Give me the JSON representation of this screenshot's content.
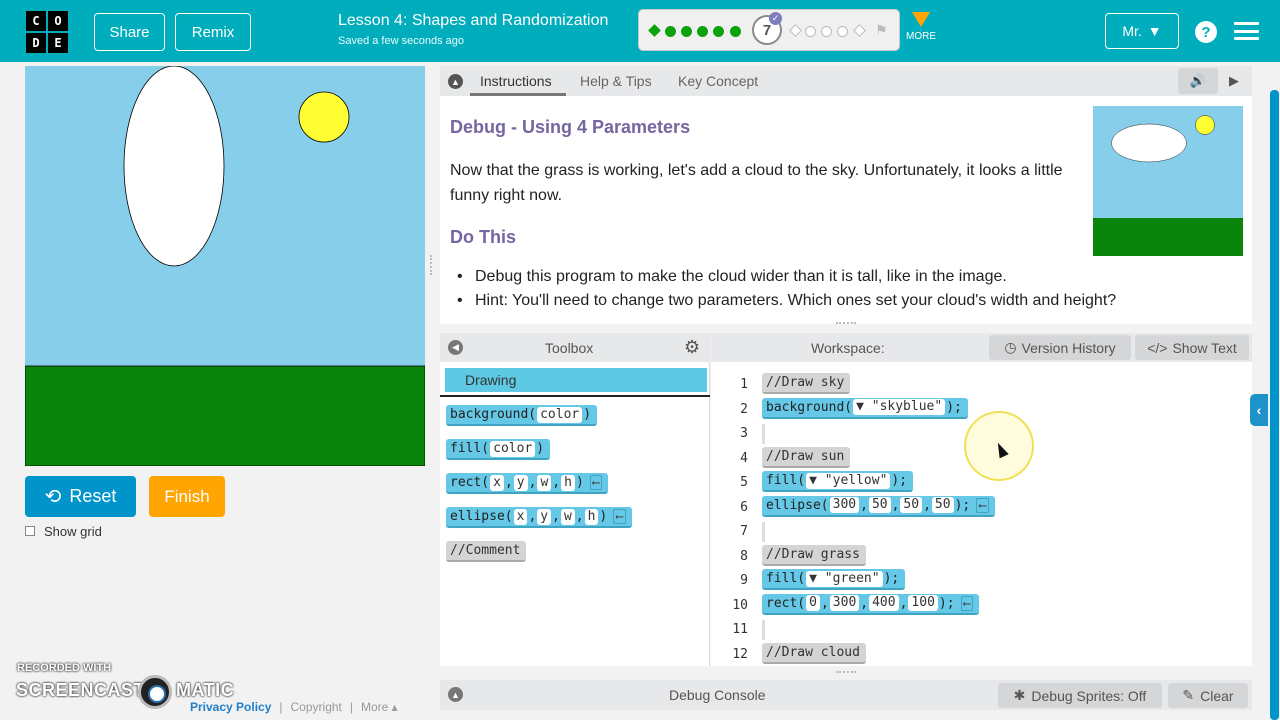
{
  "header": {
    "logo_letters": [
      "C",
      "O",
      "D",
      "E"
    ],
    "share_label": "Share",
    "remix_label": "Remix",
    "lesson_title": "Lesson 4: Shapes and Randomization",
    "saved_status": "Saved a few seconds ago",
    "progress": {
      "current_level": "7",
      "completed_levels": 6,
      "total_shown": 11
    },
    "more_label": "MORE",
    "user_label": "Mr.",
    "accent_color": "#00adbc"
  },
  "canvas": {
    "sky_color": "#87ceeb",
    "grass_color": "#0b840b",
    "sun_color": "#ffff33",
    "cloud_color": "#ffffff"
  },
  "controls": {
    "reset_label": "Reset",
    "finish_label": "Finish",
    "show_grid_label": "Show grid"
  },
  "watermark": {
    "recorded_with": "RECORDED WITH",
    "brand_left": "SCREENCAST",
    "brand_right": "MATIC"
  },
  "footer": {
    "privacy": "Privacy Policy",
    "copyright": "Copyright",
    "more": "More ▴"
  },
  "instructions": {
    "tabs": [
      "Instructions",
      "Help & Tips",
      "Key Concept"
    ],
    "heading": "Debug - Using 4 Parameters",
    "body": "Now that the grass is working, let's add a cloud to the sky. Unfortunately, it looks a little funny right now.",
    "do_this": "Do This",
    "bullets": [
      "Debug this program to make the cloud wider than it is tall, like in the image.",
      "Hint: You'll need to change two parameters. Which ones set your cloud's width and height?"
    ]
  },
  "toolbox": {
    "title": "Toolbox",
    "category": "Drawing",
    "blocks": [
      {
        "name": "background",
        "params": [
          "color"
        ],
        "has_return": false,
        "comment": false
      },
      {
        "name": "fill",
        "params": [
          "color"
        ],
        "has_return": false,
        "comment": false
      },
      {
        "name": "rect",
        "params": [
          "x",
          "y",
          "w",
          "h"
        ],
        "has_return": true,
        "comment": false
      },
      {
        "name": "ellipse",
        "params": [
          "x",
          "y",
          "w",
          "h"
        ],
        "has_return": true,
        "comment": false
      },
      {
        "name": "Comment",
        "params": [],
        "has_return": false,
        "comment": true
      }
    ]
  },
  "workspace": {
    "title": "Workspace:",
    "version_history_label": "Version History",
    "show_text_label": "Show Text",
    "lines": [
      {
        "num": "1",
        "kind": "comment",
        "text": "Draw sky"
      },
      {
        "num": "2",
        "kind": "call",
        "fn": "background",
        "dropdown": true,
        "args": [
          "\"skyblue\""
        ],
        "ret": false
      },
      {
        "num": "3",
        "kind": "blank"
      },
      {
        "num": "4",
        "kind": "comment",
        "text": "Draw sun"
      },
      {
        "num": "5",
        "kind": "call",
        "fn": "fill",
        "dropdown": true,
        "args": [
          "\"yellow\""
        ],
        "ret": false
      },
      {
        "num": "6",
        "kind": "call",
        "fn": "ellipse",
        "dropdown": false,
        "args": [
          "300",
          "50",
          "50",
          "50"
        ],
        "ret": true
      },
      {
        "num": "7",
        "kind": "blank"
      },
      {
        "num": "8",
        "kind": "comment",
        "text": "Draw grass"
      },
      {
        "num": "9",
        "kind": "call",
        "fn": "fill",
        "dropdown": true,
        "args": [
          "\"green\""
        ],
        "ret": false
      },
      {
        "num": "10",
        "kind": "call",
        "fn": "rect",
        "dropdown": false,
        "args": [
          "0",
          "300",
          "400",
          "100"
        ],
        "ret": true
      },
      {
        "num": "11",
        "kind": "blank"
      },
      {
        "num": "12",
        "kind": "comment",
        "text": "Draw cloud"
      }
    ]
  },
  "debug": {
    "console_label": "Debug Console",
    "sprites_label": "Debug Sprites: Off",
    "clear_label": "Clear"
  }
}
